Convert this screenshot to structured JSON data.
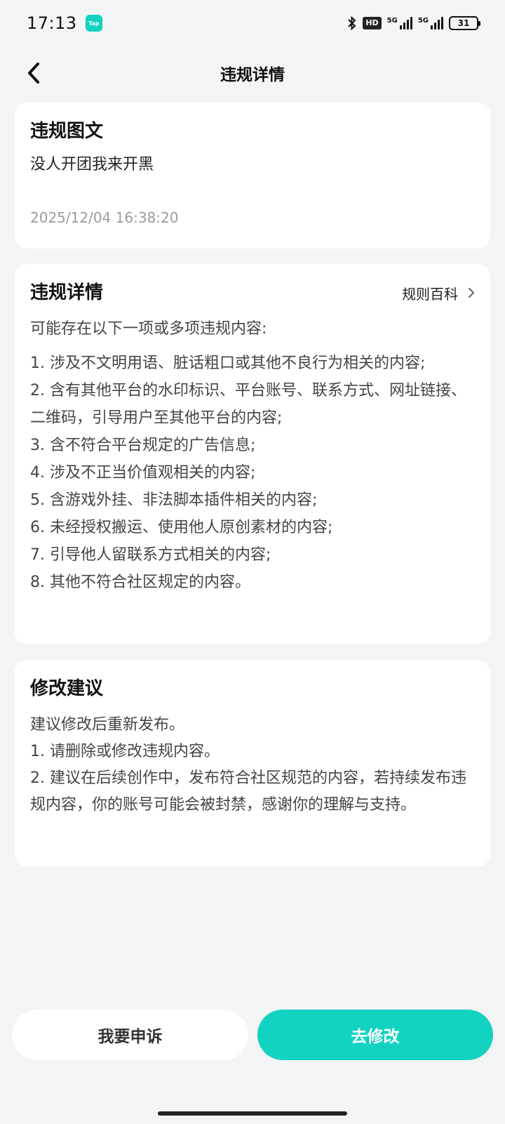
{
  "status_bar": {
    "time": "17:13",
    "app_badge": "Tap",
    "hd_label": "HD",
    "signal1_label": "5G",
    "signal2_label": "5G",
    "battery": "31"
  },
  "header": {
    "title": "违规详情"
  },
  "violation_content": {
    "title": "违规图文",
    "text": "没人开团我来开黑",
    "timestamp": "2025/12/04 16:38:20"
  },
  "violation_details": {
    "title": "违规详情",
    "rules_link": "规则百科",
    "intro": "可能存在以下一项或多项违规内容:",
    "items": [
      "1. 涉及不文明用语、脏话粗口或其他不良行为相关的内容;",
      "2. 含有其他平台的水印标识、平台账号、联系方式、网址链接、二维码，引导用户至其他平台的内容;",
      "3. 含不符合平台规定的广告信息;",
      "4. 涉及不正当价值观相关的内容;",
      "5. 含游戏外挂、非法脚本插件相关的内容;",
      "6. 未经授权搬运、使用他人原创素材的内容;",
      "7. 引导他人留联系方式相关的内容;",
      "8. 其他不符合社区规定的内容。"
    ]
  },
  "suggestions": {
    "title": "修改建议",
    "items": [
      "建议修改后重新发布。",
      "1. 请删除或修改违规内容。",
      "2. 建议在后续创作中，发布符合社区规范的内容，若持续发布违规内容，你的账号可能会被封禁，感谢你的理解与支持。"
    ]
  },
  "actions": {
    "appeal": "我要申诉",
    "modify": "去修改"
  },
  "colors": {
    "accent": "#12d3c1",
    "background": "#f3f4f6"
  }
}
